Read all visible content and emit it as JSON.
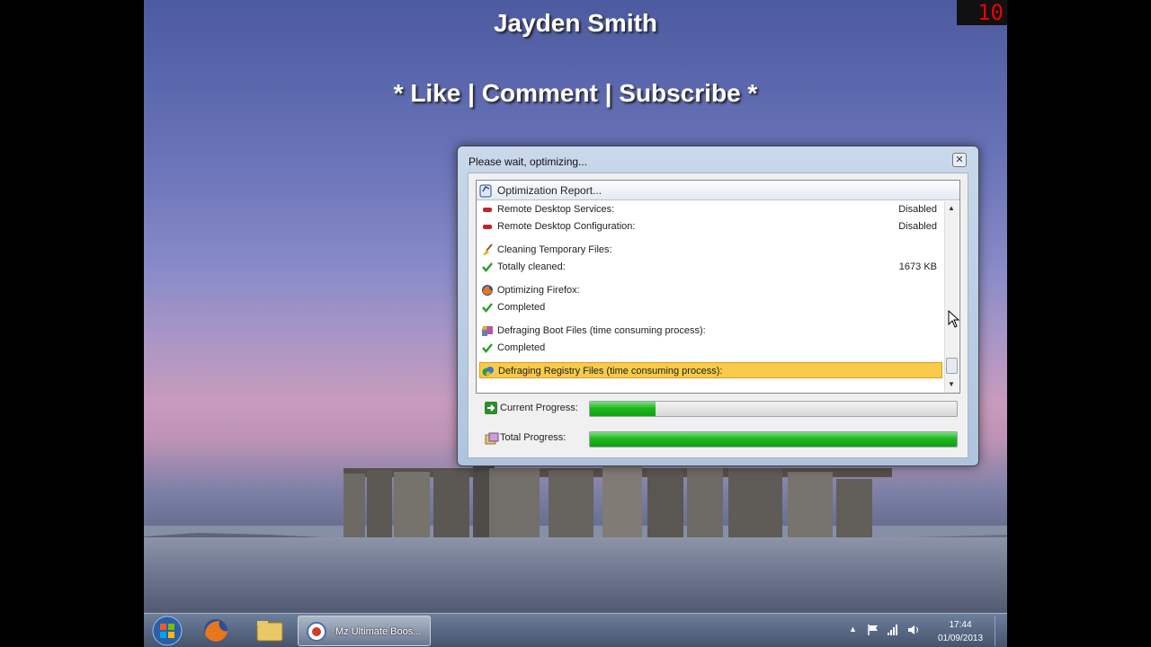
{
  "overlay": {
    "name": "Jayden Smith",
    "cta": "* Like | Comment | Subscribe *",
    "counter": "10"
  },
  "dialog": {
    "title": "Please wait, optimizing...",
    "close_symbol": "✕",
    "report_header": "Optimization Report...",
    "rows": [
      {
        "icon": "red-dash-icon",
        "label": "Remote Desktop Services:",
        "value": "Disabled"
      },
      {
        "icon": "red-dash-icon",
        "label": "Remote Desktop Configuration:",
        "value": "Disabled"
      },
      {
        "icon": "broom-icon",
        "label": "Cleaning Temporary Files:",
        "value": ""
      },
      {
        "icon": "check-icon",
        "label": "Totally cleaned:",
        "value": "1673 KB"
      },
      {
        "icon": "firefox-icon",
        "label": "Optimizing Firefox:",
        "value": ""
      },
      {
        "icon": "check-icon",
        "label": "Completed",
        "value": ""
      },
      {
        "icon": "defrag-icon",
        "label": "Defraging Boot Files (time consuming process):",
        "value": ""
      },
      {
        "icon": "check-icon",
        "label": "Completed",
        "value": ""
      },
      {
        "icon": "registry-defrag-icon",
        "label": "Defraging Registry Files (time consuming process):",
        "value": "",
        "highlighted": true
      }
    ],
    "current_progress_label": "Current Progress:",
    "current_progress": 0.18,
    "total_progress_label": "Total Progress:",
    "total_progress": 1.0
  },
  "taskbar": {
    "task_label": "Mz Ultimate Boos...",
    "time": "17:44",
    "date": "01/09/2013"
  },
  "colors": {
    "highlight": "#f9cb4a",
    "progress_fill": "#1fb81f"
  }
}
